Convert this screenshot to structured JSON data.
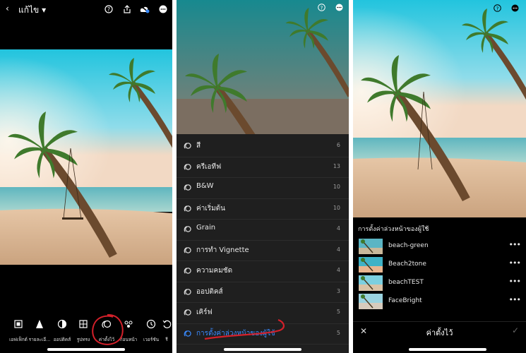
{
  "screen1": {
    "back_label": "แก้ไข",
    "tools": [
      {
        "label": "เอฟเฟ็กต์",
        "icon": "effects-icon"
      },
      {
        "label": "รายละเอี...",
        "icon": "detail-icon"
      },
      {
        "label": "ออปติคส์",
        "icon": "optics-icon"
      },
      {
        "label": "รูปทรง",
        "icon": "geometry-icon"
      },
      {
        "label": "ค่าตั้งไว้",
        "icon": "presets-icon"
      },
      {
        "label": "ก่อนหน้า",
        "icon": "previous-icon"
      },
      {
        "label": "เวอร์ชัน",
        "icon": "versions-icon"
      },
      {
        "label": "รี",
        "icon": "reset-icon"
      }
    ]
  },
  "screen2": {
    "categories": [
      {
        "label": "สี",
        "count": "6"
      },
      {
        "label": "ครีเอทีฟ",
        "count": "13"
      },
      {
        "label": "B&W",
        "count": "10"
      },
      {
        "label": "ค่าเริ่มต้น",
        "count": "10"
      },
      {
        "label": "Grain",
        "count": "4"
      },
      {
        "label": "การทำ Vignette",
        "count": "4"
      },
      {
        "label": "ความคมชัด",
        "count": "4"
      },
      {
        "label": "ออปติคส์",
        "count": "3"
      },
      {
        "label": "เคิร์ฟ",
        "count": "5"
      },
      {
        "label": "การตั้งค่าล่วงหน้าของผู้ใช้",
        "count": "5"
      }
    ]
  },
  "screen3": {
    "group_title": "การตั้งค่าล่วงหน้าของผู้ใช้",
    "presets": [
      {
        "name": "beach-green"
      },
      {
        "name": "Beach2tone"
      },
      {
        "name": "beachTEST"
      },
      {
        "name": "FaceBright"
      }
    ],
    "footer_title": "ค่าตั้งไว้",
    "more_symbol": "•••"
  },
  "colors": {
    "accent_blue": "#3a8bff",
    "annotation_red": "#d4202a"
  }
}
